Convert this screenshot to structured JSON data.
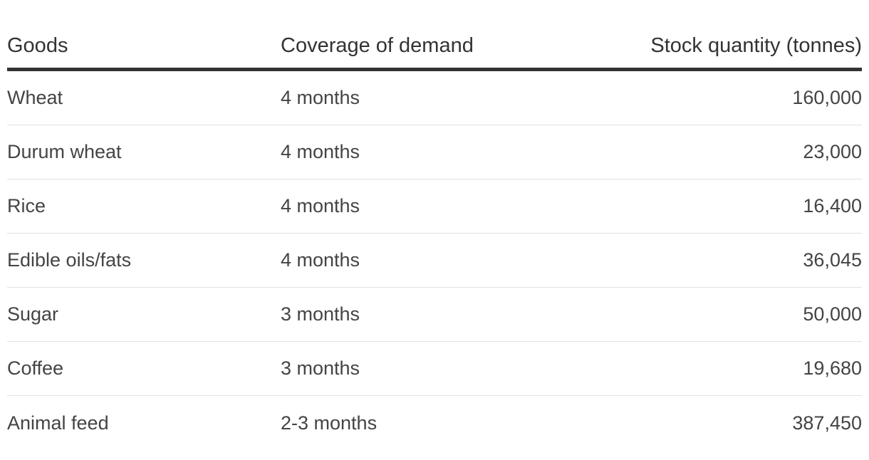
{
  "table": {
    "headers": [
      "Goods",
      "Coverage of demand",
      "Stock quantity (tonnes)"
    ],
    "rows": [
      [
        "Wheat",
        "4 months",
        "160,000"
      ],
      [
        "Durum wheat",
        "4 months",
        "23,000"
      ],
      [
        "Rice",
        "4 months",
        "16,400"
      ],
      [
        "Edible oils/fats",
        "4 months",
        "36,045"
      ],
      [
        "Sugar",
        "3 months",
        "50,000"
      ],
      [
        "Coffee",
        "3 months",
        "19,680"
      ],
      [
        "Animal feed",
        "2-3 months",
        "387,450"
      ]
    ]
  }
}
